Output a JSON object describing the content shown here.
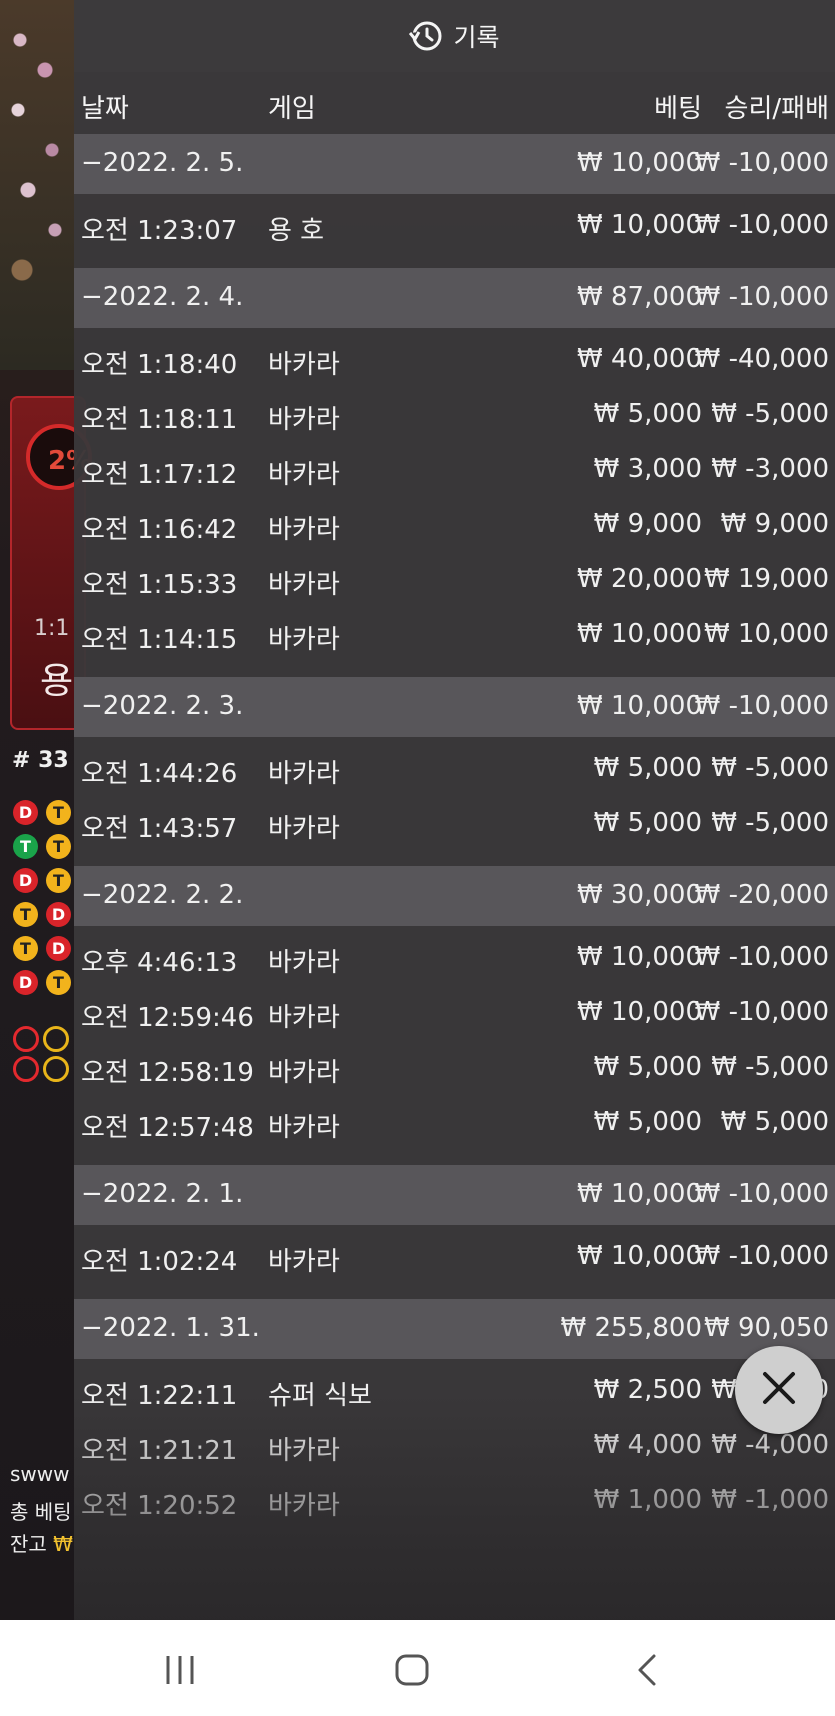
{
  "header": {
    "title": "기록",
    "icon": "history-icon"
  },
  "columns": {
    "date": "날짜",
    "game": "게임",
    "bet": "베팅",
    "winloss": "승리/패배"
  },
  "rows": [
    {
      "type": "date",
      "time": "−2022. 2. 5.",
      "game": "",
      "bet": "₩ 10,000",
      "winloss": "₩ -10,000"
    },
    {
      "type": "entry",
      "time": "오전 1:23:07",
      "game": "용 호",
      "bet": "₩ 10,000",
      "winloss": "₩ -10,000"
    },
    {
      "type": "date",
      "time": "−2022. 2. 4.",
      "game": "",
      "bet": "₩ 87,000",
      "winloss": "₩ -10,000"
    },
    {
      "type": "entry",
      "time": "오전 1:18:40",
      "game": "바카라",
      "bet": "₩ 40,000",
      "winloss": "₩ -40,000"
    },
    {
      "type": "entry",
      "time": "오전 1:18:11",
      "game": "바카라",
      "bet": "₩ 5,000",
      "winloss": "₩ -5,000"
    },
    {
      "type": "entry",
      "time": "오전 1:17:12",
      "game": "바카라",
      "bet": "₩ 3,000",
      "winloss": "₩ -3,000"
    },
    {
      "type": "entry",
      "time": "오전 1:16:42",
      "game": "바카라",
      "bet": "₩ 9,000",
      "winloss": "₩ 9,000"
    },
    {
      "type": "entry",
      "time": "오전 1:15:33",
      "game": "바카라",
      "bet": "₩ 20,000",
      "winloss": "₩ 19,000"
    },
    {
      "type": "entry",
      "time": "오전 1:14:15",
      "game": "바카라",
      "bet": "₩ 10,000",
      "winloss": "₩ 10,000"
    },
    {
      "type": "date",
      "time": "−2022. 2. 3.",
      "game": "",
      "bet": "₩ 10,000",
      "winloss": "₩ -10,000"
    },
    {
      "type": "entry",
      "time": "오전 1:44:26",
      "game": "바카라",
      "bet": "₩ 5,000",
      "winloss": "₩ -5,000"
    },
    {
      "type": "entry",
      "time": "오전 1:43:57",
      "game": "바카라",
      "bet": "₩ 5,000",
      "winloss": "₩ -5,000"
    },
    {
      "type": "date",
      "time": "−2022. 2. 2.",
      "game": "",
      "bet": "₩ 30,000",
      "winloss": "₩ -20,000"
    },
    {
      "type": "entry",
      "time": "오후 4:46:13",
      "game": "바카라",
      "bet": "₩ 10,000",
      "winloss": "₩ -10,000"
    },
    {
      "type": "entry",
      "time": "오전 12:59:46",
      "game": "바카라",
      "bet": "₩ 10,000",
      "winloss": "₩ -10,000"
    },
    {
      "type": "entry",
      "time": "오전 12:58:19",
      "game": "바카라",
      "bet": "₩ 5,000",
      "winloss": "₩ -5,000"
    },
    {
      "type": "entry",
      "time": "오전 12:57:48",
      "game": "바카라",
      "bet": "₩ 5,000",
      "winloss": "₩ 5,000"
    },
    {
      "type": "date",
      "time": "−2022. 2. 1.",
      "game": "",
      "bet": "₩ 10,000",
      "winloss": "₩ -10,000"
    },
    {
      "type": "entry",
      "time": "오전 1:02:24",
      "game": "바카라",
      "bet": "₩ 10,000",
      "winloss": "₩ -10,000"
    },
    {
      "type": "date",
      "time": "−2022. 1. 31.",
      "game": "",
      "bet": "₩ 255,800",
      "winloss": "₩ 90,050"
    },
    {
      "type": "entry",
      "time": "오전 1:22:11",
      "game": "슈퍼 식보",
      "bet": "₩ 2,500",
      "winloss": "₩ -2,500"
    },
    {
      "type": "entry",
      "time": "오전 1:21:21",
      "game": "바카라",
      "bet": "₩ 4,000",
      "winloss": "₩ -4,000"
    },
    {
      "type": "entry",
      "time": "오전 1:20:52",
      "game": "바카라",
      "bet": "₩ 1,000",
      "winloss": "₩ -1,000"
    }
  ],
  "background": {
    "dragon_percent": "2%",
    "ratio": "1:1",
    "dragon_label": "용",
    "shoe_number": "# 33",
    "chat_user": "swww",
    "total_bet_label": "총 베팅",
    "balance_label": "잔고",
    "balance_symbol": "₩"
  },
  "close": {
    "icon": "close-icon"
  },
  "navbar": {
    "icons": [
      "recent-apps-icon",
      "home-icon",
      "back-icon"
    ]
  },
  "colors": {
    "panel": "#3a383a",
    "date_row": "#58565a",
    "navbar": "#ffffff"
  }
}
